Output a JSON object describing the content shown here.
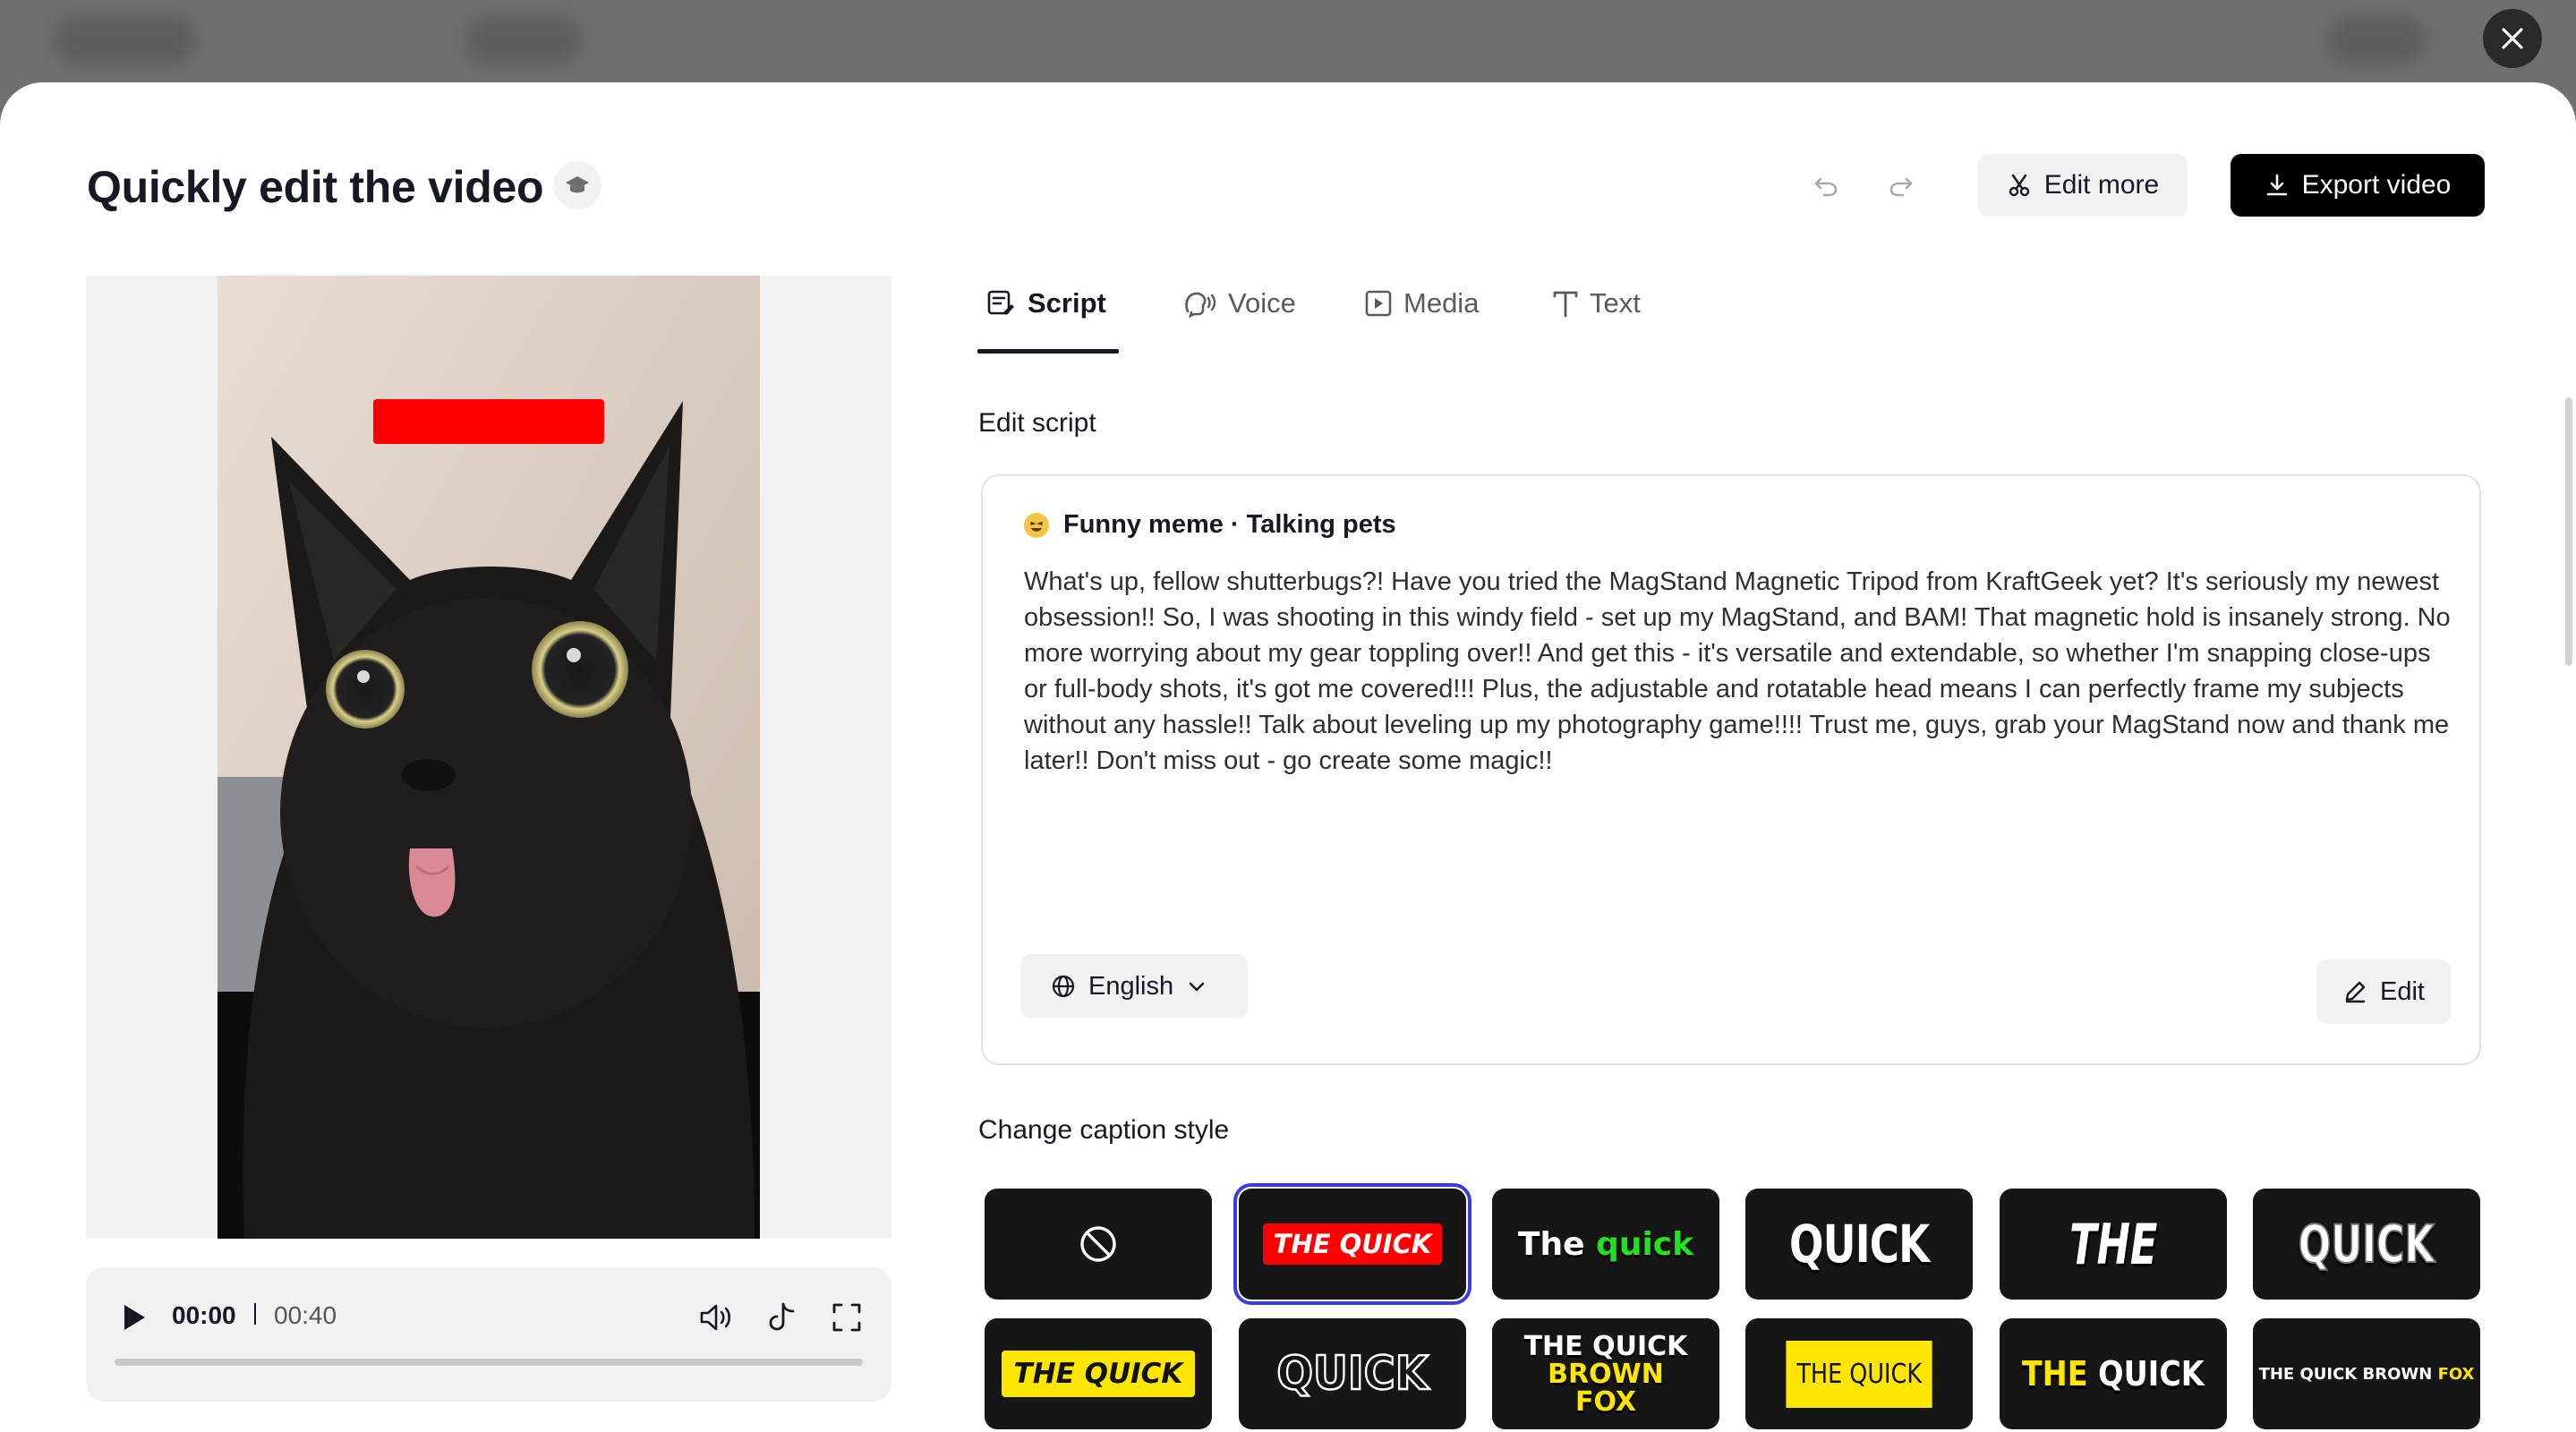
{
  "header": {
    "title": "Quickly edit the video",
    "edit_more_label": "Edit more",
    "export_label": "Export video"
  },
  "player": {
    "current_time": "00:00",
    "total_time": "00:40",
    "progress": 0
  },
  "tabs": [
    {
      "label": "Script",
      "icon": "script-icon",
      "active": true
    },
    {
      "label": "Voice",
      "icon": "voice-icon",
      "active": false
    },
    {
      "label": "Media",
      "icon": "media-icon",
      "active": false
    },
    {
      "label": "Text",
      "icon": "text-icon",
      "active": false
    }
  ],
  "script": {
    "section_label": "Edit script",
    "category": "Funny meme · Talking pets",
    "body": "What's up, fellow shutterbugs?! Have you tried the MagStand Magnetic Tripod from KraftGeek yet? It's seriously my newest obsession!! So, I was shooting in this windy field - set up my MagStand, and BAM! That magnetic hold is insanely strong. No more worrying about my gear toppling over!! And get this - it's versatile and extendable, so whether I'm snapping close-ups or full-body shots, it's got me covered!!! Plus, the adjustable and rotatable head means I can perfectly frame my subjects without any hassle!! Talk about leveling up my photography game!!!! Trust me, guys, grab your MagStand now and thank me later!! Don't miss out - go create some magic!!",
    "language": "English",
    "edit_label": "Edit"
  },
  "captions": {
    "section_label": "Change caption style",
    "styles": [
      {
        "text": "",
        "icon": "none-icon"
      },
      {
        "text": "THE QUICK",
        "selected": true
      },
      {
        "text": "The quick",
        "highlight": "quick"
      },
      {
        "text": "QUICK"
      },
      {
        "text": "THE"
      },
      {
        "text": "QUICK"
      },
      {
        "text": "THE QUICK"
      },
      {
        "text": "QUICK"
      },
      {
        "text": "THE QUICK BROWN FOX"
      },
      {
        "text": "THE QUICK"
      },
      {
        "text": "THE QUICK"
      },
      {
        "text": "THE QUICK BROWN FOX"
      }
    ]
  },
  "colors": {
    "accent_selected": "#3b3bd9",
    "caption_red": "#ff0000",
    "caption_green": "#22e022",
    "caption_yellow": "#ffe600"
  }
}
